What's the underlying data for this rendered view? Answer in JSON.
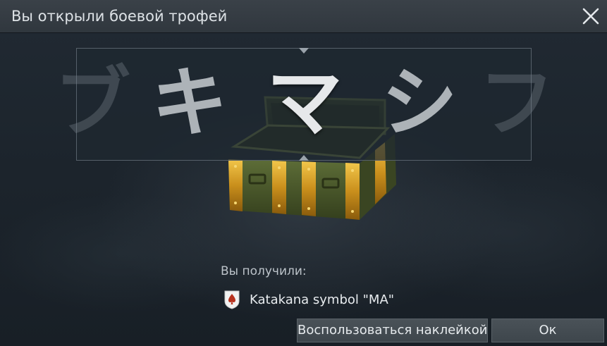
{
  "window": {
    "title": "Вы открыли боевой трофей"
  },
  "icons": {
    "close": "close-icon",
    "reward": "decal-icon"
  },
  "carousel": {
    "items": [
      {
        "symbol": "ブ"
      },
      {
        "symbol": "キ"
      },
      {
        "symbol": "マ"
      },
      {
        "symbol": "シ"
      },
      {
        "symbol": "フ"
      }
    ],
    "selected_index": 2
  },
  "reward": {
    "label": "Вы получили:",
    "name": "Katakana symbol \"MA\""
  },
  "buttons": {
    "use": "Воспользоваться наклейкой",
    "ok": "Ок"
  },
  "colors": {
    "titlebar": "#353c43",
    "background": "#1e262e",
    "chest_gold": "#c98f1c",
    "chest_green": "#4a5a2c"
  }
}
